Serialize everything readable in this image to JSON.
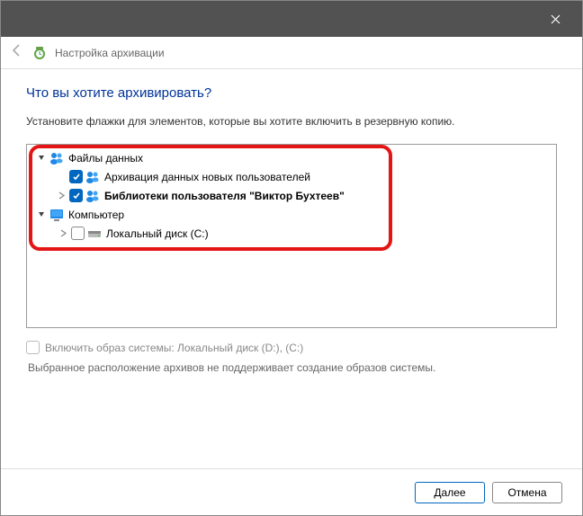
{
  "header": {
    "title": "Настройка архивации"
  },
  "content": {
    "heading": "Что вы хотите архивировать?",
    "subtext": "Установите флажки для элементов, которые вы хотите включить в резервную копию."
  },
  "tree": {
    "data_files": {
      "label": "Файлы данных",
      "new_users": "Архивация данных новых пользователей",
      "libraries": "Библиотеки пользователя \"Виктор Бухтеев\""
    },
    "computer": {
      "label": "Компьютер",
      "local_disk": "Локальный диск (C:)"
    }
  },
  "system_image": {
    "label": "Включить образ системы: Локальный диск (D:), (C:)",
    "warning": "Выбранное расположение архивов не поддерживает создание образов системы."
  },
  "footer": {
    "next": "Далее",
    "cancel": "Отмена"
  }
}
